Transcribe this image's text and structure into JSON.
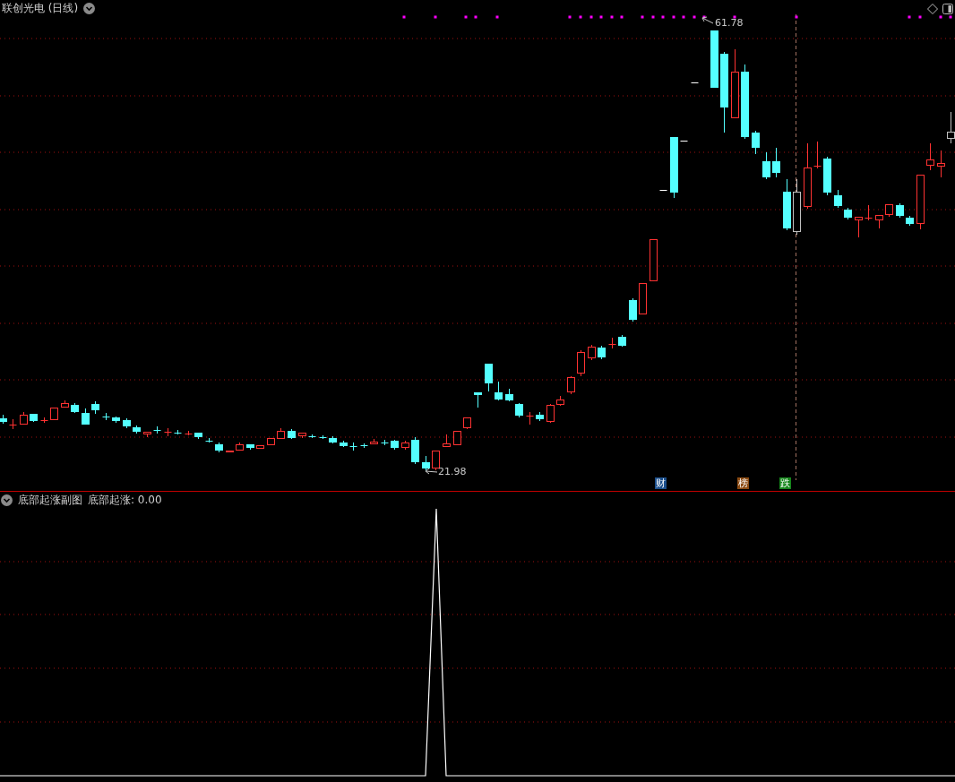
{
  "main_chart": {
    "title": "联创光电 (日线)",
    "high_label": "61.78",
    "low_label": "21.98",
    "markers": [
      {
        "label": "财",
        "color": "#1c4f8c"
      },
      {
        "label": "榜",
        "color": "#8b4a12"
      },
      {
        "label": "跌",
        "color": "#16861c"
      }
    ]
  },
  "sub_chart": {
    "title": "底部起涨副图",
    "value_label": "底部起涨: 0.00"
  }
}
